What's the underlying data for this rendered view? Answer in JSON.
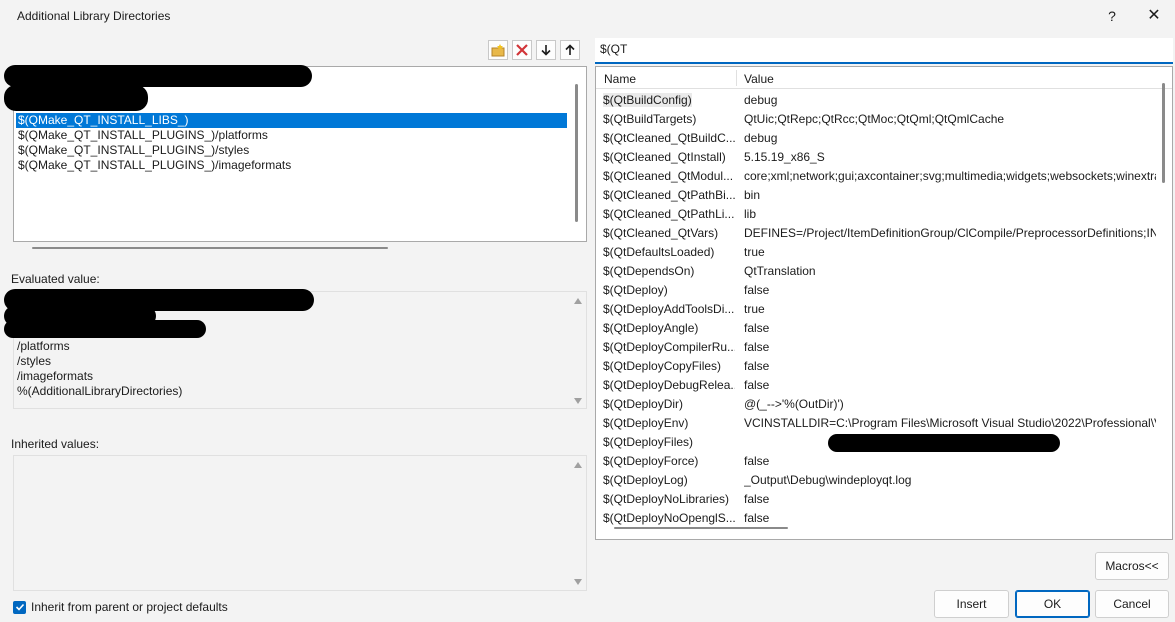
{
  "window": {
    "title": "Additional Library Directories",
    "help_label": "?",
    "close_label": "✕"
  },
  "toolbar": {
    "new_line_icon": "new-line-icon",
    "delete_icon": "delete-icon",
    "move_down_icon": "arrow-down-icon",
    "move_up_icon": "arrow-up-icon"
  },
  "directories": [
    "$(QMake_QT_INSTALL_LIBS_)",
    "$(QMake_QT_INSTALL_PLUGINS_)/platforms",
    "$(QMake_QT_INSTALL_PLUGINS_)/styles",
    "$(QMake_QT_INSTALL_PLUGINS_)/imageformats"
  ],
  "evaluated": {
    "label": "Evaluated value:",
    "lines": [
      "/platforms",
      "/styles",
      "/imageformats",
      "%(AdditionalLibraryDirectories)"
    ]
  },
  "inherited": {
    "label": "Inherited values:"
  },
  "inherit_checkbox": {
    "label": "Inherit from parent or project defaults",
    "checked": true
  },
  "macro_search": {
    "value": "$(QT"
  },
  "macro_table": {
    "col_name": "Name",
    "col_value": "Value",
    "rows": [
      {
        "name": "$(QtBuildConfig)",
        "value": "debug"
      },
      {
        "name": "$(QtBuildTargets)",
        "value": "QtUic;QtRepc;QtRcc;QtMoc;QtQml;QtQmlCache"
      },
      {
        "name": "$(QtCleaned_QtBuildC...",
        "value": "debug"
      },
      {
        "name": "$(QtCleaned_QtInstall)",
        "value": "5.15.19_x86_S"
      },
      {
        "name": "$(QtCleaned_QtModul...",
        "value": "core;xml;network;gui;axcontainer;svg;multimedia;widgets;websockets;winextra"
      },
      {
        "name": "$(QtCleaned_QtPathBi...",
        "value": "bin"
      },
      {
        "name": "$(QtCleaned_QtPathLi...",
        "value": "lib"
      },
      {
        "name": "$(QtCleaned_QtVars)",
        "value": "DEFINES=/Project/ItemDefinitionGroup/ClCompile/PreprocessorDefinitions;IN"
      },
      {
        "name": "$(QtDefaultsLoaded)",
        "value": "true"
      },
      {
        "name": "$(QtDependsOn)",
        "value": "QtTranslation"
      },
      {
        "name": "$(QtDeploy)",
        "value": "false"
      },
      {
        "name": "$(QtDeployAddToolsDi...",
        "value": "true"
      },
      {
        "name": "$(QtDeployAngle)",
        "value": "false"
      },
      {
        "name": "$(QtDeployCompilerRu...",
        "value": "false"
      },
      {
        "name": "$(QtDeployCopyFiles)",
        "value": "false"
      },
      {
        "name": "$(QtDeployDebugRelea...",
        "value": "false"
      },
      {
        "name": "$(QtDeployDir)",
        "value": "@(_-->'%(OutDir)')"
      },
      {
        "name": "$(QtDeployEnv)",
        "value": "VCINSTALLDIR=C:\\Program Files\\Microsoft Visual Studio\\2022\\Professional\\VC"
      },
      {
        "name": "$(QtDeployFiles)",
        "value": ""
      },
      {
        "name": "$(QtDeployForce)",
        "value": "false"
      },
      {
        "name": "$(QtDeployLog)",
        "value": "_Output\\Debug\\windeployqt.log"
      },
      {
        "name": "$(QtDeployNoLibraries)",
        "value": "false"
      },
      {
        "name": "$(QtDeployNoOpenglS...",
        "value": "false"
      }
    ]
  },
  "buttons": {
    "macros": "Macros<<",
    "insert": "Insert",
    "ok": "OK",
    "cancel": "Cancel"
  }
}
